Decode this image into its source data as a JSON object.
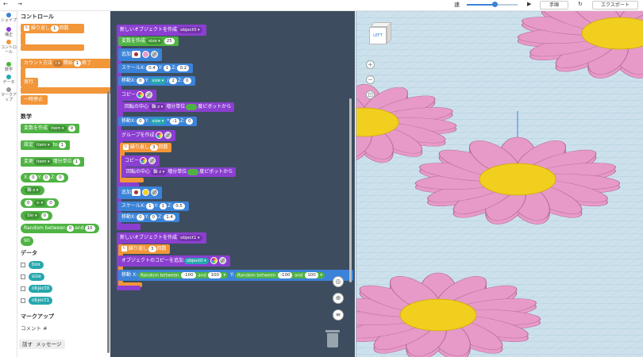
{
  "topbar": {
    "undo": "←",
    "redo": "→",
    "speed_label": "速",
    "speed_level": 0.55,
    "play": "▶",
    "step_label": "手順",
    "reset": "↻",
    "export_label": "エクスポート"
  },
  "categories": [
    {
      "label": "シェイプ",
      "color": "#3b83d8"
    },
    {
      "label": "補正",
      "color": "#8b3fd0"
    },
    {
      "label": "コントロール",
      "color": "#f2963a"
    },
    {
      "label": "数学",
      "color": "#4fb343"
    },
    {
      "label": "データ",
      "color": "#25a7ad"
    },
    {
      "label": "マークアップ",
      "color": "#999999"
    }
  ],
  "palette": {
    "control_header": "コントロール",
    "repeat": {
      "label": "繰り返し",
      "count": "1",
      "suffix": "回数"
    },
    "count_with": {
      "label": "カウント方法",
      "var": "i",
      "from": "開始",
      "start": "1",
      "end": "終了"
    },
    "run": "実行",
    "pause": "一時停止",
    "math_header": "数学",
    "create_var": {
      "label": "変数を作成",
      "var": "item",
      "value": "0"
    },
    "set_var": {
      "label": "設定",
      "var": "item",
      "to": "to",
      "value": "1"
    },
    "change_var": {
      "label": "変更",
      "var": "item",
      "by": "増分単位",
      "value": "1"
    },
    "xyz": {
      "x": "X:",
      "xv": "0",
      "y": "Y:",
      "yv": "0",
      "z": "Z:",
      "zv": "0"
    },
    "axis": "軸 z",
    "arith": {
      "a": "0",
      "op": "+",
      "b": "0"
    },
    "sin": {
      "fn": "Sin",
      "v": "0"
    },
    "random": {
      "label": "Random between",
      "a": "0",
      "and": "and",
      "b": "10"
    },
    "angle": "90",
    "data_header": "データ",
    "data_vars": [
      "box",
      "size",
      "object0",
      "object1"
    ],
    "markup_header": "マークアップ",
    "comment": "コメント #",
    "say": {
      "label": "話す",
      "msg": "メッセージ"
    }
  },
  "workspace": {
    "b1": {
      "label": "新しいオブジェクトを作成",
      "name": "object0"
    },
    "b2": {
      "label": "変数を作成",
      "var": "size",
      "value": "25"
    },
    "b3": {
      "label": "追加"
    },
    "b4": {
      "label": "スケール",
      "x": "X:",
      "xv": "0.4",
      "y": "Y:",
      "yv": "1",
      "z": "Z:",
      "zv": "0.2"
    },
    "b5": {
      "label": "移動",
      "x": "X:",
      "xv": "0",
      "y": "Y:",
      "yvar": "size",
      "op": "/",
      "opv": "2",
      "z": "Z:",
      "zv": "0"
    },
    "b6": {
      "label": "コピー"
    },
    "b7": {
      "label": "回転の中心",
      "axis": "軸 z",
      "by": "増分単位",
      "deg": "度",
      "pivot": "ピボットから"
    },
    "b8": {
      "label": "移動",
      "x": "X:",
      "xv": "0",
      "y": "Y:",
      "yvar": "size",
      "op": "*",
      "opv": "-1",
      "z": "Z:",
      "zv": "0"
    },
    "b9": {
      "label": "グループを作成"
    },
    "b10": {
      "label": "繰り返し",
      "count": "3",
      "suffix": "回数"
    },
    "b11": {
      "label": "コピー"
    },
    "b12": {
      "label": "回転の中心",
      "axis": "軸 z",
      "by": "増分単位",
      "deg": "度",
      "pivot": "ピボットから"
    },
    "b13": {
      "label": "追加"
    },
    "b14": {
      "label": "スケール",
      "x": "X:",
      "xv": "1",
      "y": "Y:",
      "yv": "1",
      "z": "Z:",
      "zv": "0.5"
    },
    "b15": {
      "label": "移動",
      "x": "X:",
      "xv": "0",
      "y": "Y:",
      "yv": "0",
      "z": "Z:",
      "zv": "1.4"
    },
    "b16": {
      "label": "新しいオブジェクトを作成",
      "name": "object1"
    },
    "b17": {
      "label": "繰り返し",
      "count": "3",
      "suffix": "回数"
    },
    "b18": {
      "label": "オブジェクトのコピーを追加",
      "name": "object0"
    },
    "b19": {
      "label": "移動",
      "x": "X:",
      "r1": "Random between",
      "r1a": "-100",
      "and": "and",
      "r1b": "100",
      "y": "Y:",
      "r2": "Random between",
      "r2a": "-100",
      "r2b": "100"
    }
  },
  "viewport": {
    "viewcube_label": "LEFT",
    "zoom_in": "+",
    "zoom_out": "−",
    "fit": "⊡",
    "center": "◎",
    "zoom_plus": "⊕",
    "menu": "≡",
    "trash": "🗑"
  },
  "colors": {
    "control": "#f2963a",
    "math": "#4fb343",
    "shape": "#3b83d8",
    "modify": "#8b3fd0",
    "data": "#25a7ad",
    "workspace_bg": "#3d4d5f",
    "petal": "#e79ac8",
    "center": "#f1cf1e",
    "grid_bg": "#cde1ec"
  }
}
